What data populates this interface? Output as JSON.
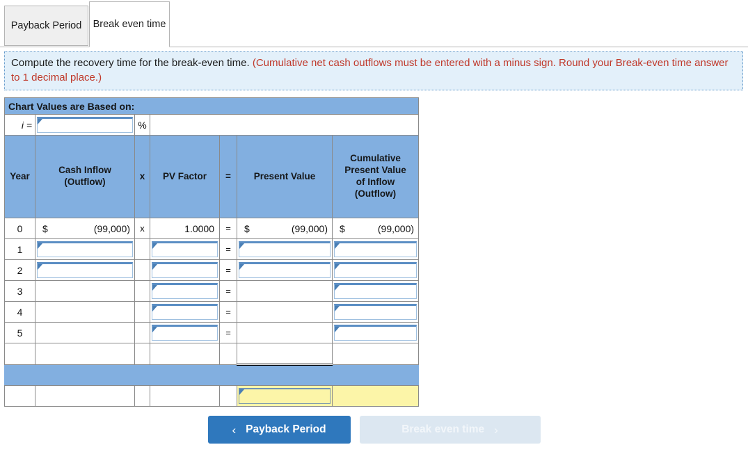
{
  "tabs": [
    {
      "label": "Payback Period",
      "active": false
    },
    {
      "label": "Break even time",
      "active": true
    }
  ],
  "instruction": {
    "main": "Compute the recovery time for the break-even time. ",
    "note": "(Cumulative net cash outflows must be entered with a minus sign. Round your Break-even time answer to 1 decimal place.)"
  },
  "worksheet": {
    "title": "Chart Values are Based on:",
    "rate_label": "i =",
    "rate_value": "",
    "rate_placeholder": "",
    "percent_symbol": "%",
    "columns": {
      "year": "Year",
      "cash_inflow": "Cash Inflow (Outflow)",
      "cash_inflow_line1": "Cash Inflow",
      "cash_inflow_line2": "(Outflow)",
      "times": "x",
      "pv_factor": "PV Factor",
      "equals": "=",
      "present_value": "Present Value",
      "cumulative_line1": "Cumulative",
      "cumulative_line2": "Present Value",
      "cumulative_line3": "of Inflow",
      "cumulative_line4": "(Outflow)"
    },
    "rows": [
      {
        "year": "0",
        "cash_symbol": "$",
        "cash_amount": "(99,000)",
        "times": "x",
        "pv_factor": "1.0000",
        "equals": "=",
        "pv_symbol": "$",
        "pv_amount": "(99,000)",
        "cum_symbol": "$",
        "cum_amount": "(99,000)",
        "editable": false
      },
      {
        "year": "1",
        "editable": true,
        "inputs": [
          "cash",
          "factor",
          "pv",
          "cum"
        ]
      },
      {
        "year": "2",
        "editable": true,
        "inputs": [
          "cash",
          "factor",
          "pv",
          "cum"
        ]
      },
      {
        "year": "3",
        "editable": true,
        "inputs": [
          "factor",
          "cum"
        ]
      },
      {
        "year": "4",
        "editable": true,
        "inputs": [
          "factor",
          "cum"
        ]
      },
      {
        "year": "5",
        "editable": true,
        "inputs": [
          "factor",
          "cum"
        ]
      }
    ],
    "total_row": {
      "year": "",
      "value": ""
    },
    "answer_row": {
      "label": "",
      "value": "",
      "cumulative": ""
    }
  },
  "navigation": {
    "prev_label": "Payback Period",
    "prev_icon": "chevron-left",
    "prev_glyph": "‹",
    "next_label": "Break even time",
    "next_icon": "chevron-right",
    "next_glyph": "›"
  },
  "colors": {
    "header_blue": "#82AFE0",
    "banner_blue": "#e3f0fa",
    "note_red": "#c0392b",
    "button_blue": "#2f78bd",
    "button_disabled": "#dce7f1",
    "answer_yellow": "#fcf5a8"
  }
}
